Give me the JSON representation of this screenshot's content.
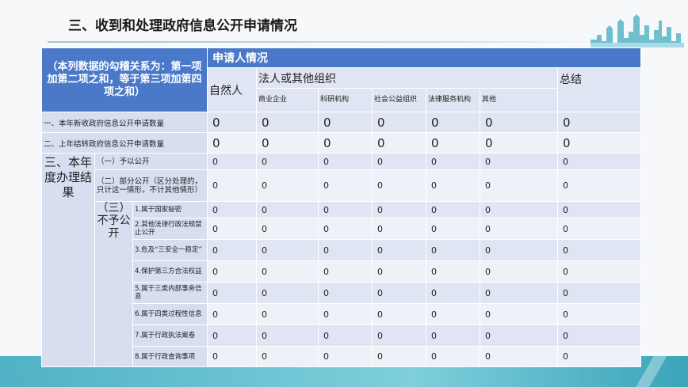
{
  "title": "三、收到和处理政府信息公开申请情况",
  "header": {
    "corner_note": "（本列数据的勾稽关系为：第一项加第二项之和，等于第三项加第四项之和）",
    "applicant": "申请人情况",
    "natural_person": "自然人",
    "legal_org": "法人或其他组织",
    "total": "总结",
    "sub_columns": [
      "商业企业",
      "科研机构",
      "社会公益组织",
      "法律服务机构",
      "其他"
    ]
  },
  "rows": {
    "new_received": {
      "label": "一、本年新收政府信息公开申请数量",
      "values": [
        "0",
        "0",
        "0",
        "0",
        "0",
        "0",
        "0"
      ]
    },
    "carried_over": {
      "label": "二、上年结转政府信息公开申请数量",
      "values": [
        "0",
        "0",
        "0",
        "0",
        "0",
        "0",
        "0"
      ]
    },
    "result_group_label": "三、本年度办理结果",
    "public": {
      "label": "（一）予以公开",
      "values": [
        "0",
        "0",
        "0",
        "0",
        "0",
        "0",
        "0"
      ]
    },
    "partial": {
      "label": "（二）部分公开（区分处理的，只计这一情形，不计其他情形）",
      "values": [
        "0",
        "0",
        "0",
        "0",
        "0",
        "0",
        "0"
      ]
    },
    "not_public_label": "（三）不予公开",
    "not_public": [
      {
        "label": "1.属于国家秘密",
        "values": [
          "0",
          "0",
          "0",
          "0",
          "0",
          "0",
          "0"
        ]
      },
      {
        "label": "2.其他法律行政法规禁止公开",
        "values": [
          "0",
          "0",
          "0",
          "0",
          "0",
          "0",
          "0"
        ]
      },
      {
        "label": "3.危及“三安全一稳定”",
        "values": [
          "0",
          "0",
          "0",
          "0",
          "0",
          "0",
          "0"
        ]
      },
      {
        "label": "4.保护第三方合法权益",
        "values": [
          "0",
          "0",
          "0",
          "0",
          "0",
          "0",
          "0"
        ]
      },
      {
        "label": "5.属于三类内部事务信息",
        "values": [
          "0",
          "0",
          "0",
          "0",
          "0",
          "0",
          "0"
        ]
      },
      {
        "label": "6.属于四类过程性信息",
        "values": [
          "0",
          "0",
          "0",
          "0",
          "0",
          "0",
          "0"
        ]
      },
      {
        "label": "7.属于行政执法案卷",
        "values": [
          "0",
          "0",
          "0",
          "0",
          "0",
          "0",
          "0"
        ]
      },
      {
        "label": "8.属于行政查询事项",
        "values": [
          "0",
          "0",
          "0",
          "0",
          "0",
          "0",
          "0"
        ]
      }
    ]
  },
  "colors": {
    "header_blue": "#4a79c9",
    "row_label_bg": "#d6def0",
    "cell_light": "#eef1f8",
    "cell_mid": "#dfe5f2",
    "footer_teal": "#4fb2c4"
  },
  "icons": {
    "skyline": "city-skyline-icon"
  }
}
